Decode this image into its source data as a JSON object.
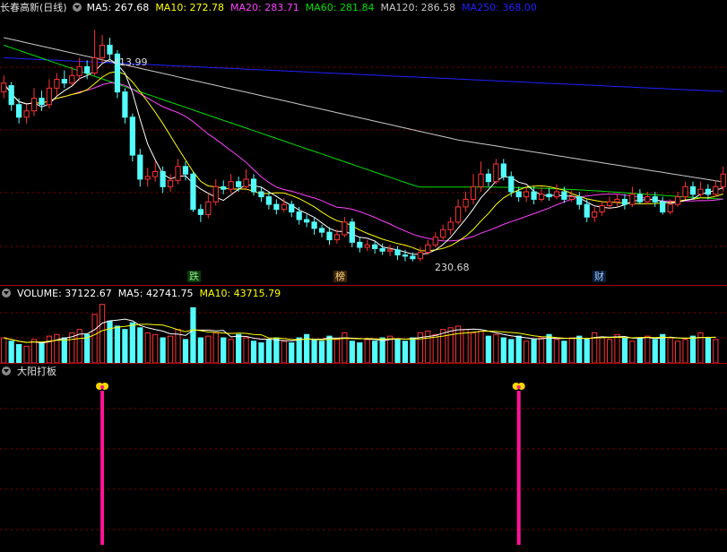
{
  "main_legend": {
    "stock": "长春高新(日线)",
    "items": [
      {
        "label": "MA5: 267.68",
        "color": "#ffffff"
      },
      {
        "label": "MA10: 272.78",
        "color": "#ffff00"
      },
      {
        "label": "MA20: 283.71",
        "color": "#ff40ff"
      },
      {
        "label": "MA60: 281.84",
        "color": "#00e000"
      },
      {
        "label": "MA120: 286.58",
        "color": "#c8c8c8"
      },
      {
        "label": "MA250: 368.00",
        "color": "#2020ff"
      }
    ]
  },
  "volume_legend": {
    "items": [
      {
        "label": "VOLUME: 37122.67",
        "color": "#ffffff"
      },
      {
        "label": "MA5: 42741.75",
        "color": "#ffffff"
      },
      {
        "label": "MA10: 43715.79",
        "color": "#ffff00"
      }
    ]
  },
  "indicator_legend": {
    "title": "大阳打板"
  },
  "annotations": {
    "high_price": "413.99",
    "low_price": "230.68",
    "event_tags": [
      "跌",
      "榜",
      "财"
    ]
  },
  "colors": {
    "up": "#ff3232",
    "down": "#54fcfc",
    "grid": "#8b0000",
    "signal": "#ff1493"
  },
  "chart_data": {
    "type": "candlestick",
    "y_range": [
      225,
      425
    ],
    "highest": 413.99,
    "lowest": 230.68,
    "candles": [
      {
        "o": 365,
        "c": 372,
        "h": 378,
        "l": 360
      },
      {
        "o": 370,
        "c": 355,
        "h": 373,
        "l": 350
      },
      {
        "o": 355,
        "c": 345,
        "h": 360,
        "l": 340
      },
      {
        "o": 345,
        "c": 350,
        "h": 355,
        "l": 340
      },
      {
        "o": 350,
        "c": 360,
        "h": 368,
        "l": 346
      },
      {
        "o": 360,
        "c": 355,
        "h": 366,
        "l": 350
      },
      {
        "o": 355,
        "c": 368,
        "h": 375,
        "l": 352
      },
      {
        "o": 368,
        "c": 375,
        "h": 380,
        "l": 362
      },
      {
        "o": 375,
        "c": 372,
        "h": 382,
        "l": 368
      },
      {
        "o": 372,
        "c": 378,
        "h": 385,
        "l": 370
      },
      {
        "o": 378,
        "c": 385,
        "h": 392,
        "l": 374
      },
      {
        "o": 385,
        "c": 380,
        "h": 390,
        "l": 375
      },
      {
        "o": 380,
        "c": 392,
        "h": 414,
        "l": 378
      },
      {
        "o": 392,
        "c": 402,
        "h": 410,
        "l": 388
      },
      {
        "o": 402,
        "c": 395,
        "h": 408,
        "l": 390
      },
      {
        "o": 395,
        "c": 365,
        "h": 398,
        "l": 360
      },
      {
        "o": 365,
        "c": 345,
        "h": 368,
        "l": 340
      },
      {
        "o": 345,
        "c": 315,
        "h": 348,
        "l": 310
      },
      {
        "o": 315,
        "c": 296,
        "h": 320,
        "l": 290
      },
      {
        "o": 296,
        "c": 298,
        "h": 305,
        "l": 290
      },
      {
        "o": 298,
        "c": 302,
        "h": 310,
        "l": 294
      },
      {
        "o": 302,
        "c": 290,
        "h": 306,
        "l": 285
      },
      {
        "o": 290,
        "c": 295,
        "h": 300,
        "l": 286
      },
      {
        "o": 295,
        "c": 306,
        "h": 312,
        "l": 292
      },
      {
        "o": 306,
        "c": 300,
        "h": 310,
        "l": 295
      },
      {
        "o": 300,
        "c": 272,
        "h": 302,
        "l": 270
      },
      {
        "o": 272,
        "c": 268,
        "h": 276,
        "l": 262
      },
      {
        "o": 268,
        "c": 278,
        "h": 284,
        "l": 265
      },
      {
        "o": 278,
        "c": 290,
        "h": 296,
        "l": 275
      },
      {
        "o": 290,
        "c": 288,
        "h": 295,
        "l": 284
      },
      {
        "o": 288,
        "c": 294,
        "h": 300,
        "l": 285
      },
      {
        "o": 294,
        "c": 290,
        "h": 298,
        "l": 286
      },
      {
        "o": 290,
        "c": 296,
        "h": 304,
        "l": 287
      },
      {
        "o": 296,
        "c": 286,
        "h": 300,
        "l": 283
      },
      {
        "o": 286,
        "c": 282,
        "h": 290,
        "l": 278
      },
      {
        "o": 282,
        "c": 276,
        "h": 286,
        "l": 272
      },
      {
        "o": 276,
        "c": 272,
        "h": 280,
        "l": 268
      },
      {
        "o": 272,
        "c": 276,
        "h": 281,
        "l": 270
      },
      {
        "o": 276,
        "c": 270,
        "h": 279,
        "l": 266
      },
      {
        "o": 270,
        "c": 264,
        "h": 274,
        "l": 260
      },
      {
        "o": 264,
        "c": 262,
        "h": 268,
        "l": 258
      },
      {
        "o": 262,
        "c": 257,
        "h": 266,
        "l": 252
      },
      {
        "o": 257,
        "c": 254,
        "h": 260,
        "l": 250
      },
      {
        "o": 254,
        "c": 248,
        "h": 258,
        "l": 244
      },
      {
        "o": 248,
        "c": 252,
        "h": 256,
        "l": 245
      },
      {
        "o": 252,
        "c": 262,
        "h": 266,
        "l": 250
      },
      {
        "o": 262,
        "c": 246,
        "h": 265,
        "l": 242
      },
      {
        "o": 246,
        "c": 242,
        "h": 250,
        "l": 238
      },
      {
        "o": 242,
        "c": 244,
        "h": 248,
        "l": 239
      },
      {
        "o": 244,
        "c": 241,
        "h": 247,
        "l": 237
      },
      {
        "o": 241,
        "c": 239,
        "h": 245,
        "l": 236
      },
      {
        "o": 239,
        "c": 240,
        "h": 244,
        "l": 235
      },
      {
        "o": 240,
        "c": 236,
        "h": 243,
        "l": 232
      },
      {
        "o": 236,
        "c": 235,
        "h": 240,
        "l": 231
      },
      {
        "o": 235,
        "c": 233,
        "h": 238,
        "l": 231
      },
      {
        "o": 233,
        "c": 238,
        "h": 242,
        "l": 231
      },
      {
        "o": 238,
        "c": 244,
        "h": 248,
        "l": 236
      },
      {
        "o": 244,
        "c": 250,
        "h": 254,
        "l": 242
      },
      {
        "o": 250,
        "c": 256,
        "h": 260,
        "l": 248
      },
      {
        "o": 256,
        "c": 262,
        "h": 266,
        "l": 252
      },
      {
        "o": 262,
        "c": 274,
        "h": 280,
        "l": 260
      },
      {
        "o": 274,
        "c": 280,
        "h": 286,
        "l": 270
      },
      {
        "o": 280,
        "c": 290,
        "h": 300,
        "l": 276
      },
      {
        "o": 290,
        "c": 300,
        "h": 310,
        "l": 286
      },
      {
        "o": 300,
        "c": 294,
        "h": 304,
        "l": 290
      },
      {
        "o": 294,
        "c": 308,
        "h": 312,
        "l": 292
      },
      {
        "o": 308,
        "c": 298,
        "h": 312,
        "l": 295
      },
      {
        "o": 298,
        "c": 286,
        "h": 302,
        "l": 282
      },
      {
        "o": 286,
        "c": 282,
        "h": 290,
        "l": 278
      },
      {
        "o": 282,
        "c": 286,
        "h": 290,
        "l": 278
      },
      {
        "o": 286,
        "c": 280,
        "h": 290,
        "l": 276
      },
      {
        "o": 280,
        "c": 284,
        "h": 290,
        "l": 278
      },
      {
        "o": 284,
        "c": 282,
        "h": 289,
        "l": 279
      },
      {
        "o": 282,
        "c": 286,
        "h": 292,
        "l": 280
      },
      {
        "o": 286,
        "c": 280,
        "h": 290,
        "l": 277
      },
      {
        "o": 280,
        "c": 282,
        "h": 287,
        "l": 278
      },
      {
        "o": 282,
        "c": 276,
        "h": 286,
        "l": 272
      },
      {
        "o": 276,
        "c": 266,
        "h": 280,
        "l": 262
      },
      {
        "o": 266,
        "c": 270,
        "h": 274,
        "l": 262
      },
      {
        "o": 270,
        "c": 275,
        "h": 279,
        "l": 267
      },
      {
        "o": 275,
        "c": 278,
        "h": 282,
        "l": 272
      },
      {
        "o": 278,
        "c": 280,
        "h": 284,
        "l": 274
      },
      {
        "o": 280,
        "c": 276,
        "h": 284,
        "l": 272
      },
      {
        "o": 276,
        "c": 284,
        "h": 290,
        "l": 274
      },
      {
        "o": 284,
        "c": 278,
        "h": 288,
        "l": 276
      },
      {
        "o": 278,
        "c": 282,
        "h": 286,
        "l": 276
      },
      {
        "o": 282,
        "c": 278,
        "h": 286,
        "l": 274
      },
      {
        "o": 278,
        "c": 270,
        "h": 282,
        "l": 268
      },
      {
        "o": 270,
        "c": 276,
        "h": 280,
        "l": 268
      },
      {
        "o": 276,
        "c": 282,
        "h": 286,
        "l": 274
      },
      {
        "o": 282,
        "c": 290,
        "h": 294,
        "l": 280
      },
      {
        "o": 290,
        "c": 284,
        "h": 294,
        "l": 280
      },
      {
        "o": 284,
        "c": 288,
        "h": 294,
        "l": 282
      },
      {
        "o": 288,
        "c": 284,
        "h": 292,
        "l": 280
      },
      {
        "o": 284,
        "c": 290,
        "h": 295,
        "l": 282
      },
      {
        "o": 290,
        "c": 300,
        "h": 306,
        "l": 286
      }
    ],
    "volumes": [
      30,
      26,
      22,
      20,
      28,
      24,
      32,
      34,
      30,
      36,
      40,
      34,
      58,
      70,
      50,
      44,
      40,
      48,
      42,
      36,
      34,
      30,
      32,
      40,
      28,
      66,
      30,
      32,
      36,
      30,
      28,
      34,
      30,
      26,
      24,
      28,
      30,
      26,
      24,
      30,
      34,
      28,
      26,
      32,
      28,
      36,
      26,
      24,
      28,
      26,
      30,
      32,
      28,
      26,
      30,
      36,
      38,
      34,
      40,
      42,
      44,
      40,
      36,
      38,
      32,
      34,
      30,
      28,
      32,
      26,
      28,
      30,
      34,
      28,
      26,
      30,
      32,
      28,
      36,
      30,
      28,
      34,
      30,
      26,
      30,
      32,
      28,
      34,
      30,
      26,
      28,
      32,
      36,
      30,
      28
    ],
    "signal_bars": [
      13,
      68
    ]
  }
}
